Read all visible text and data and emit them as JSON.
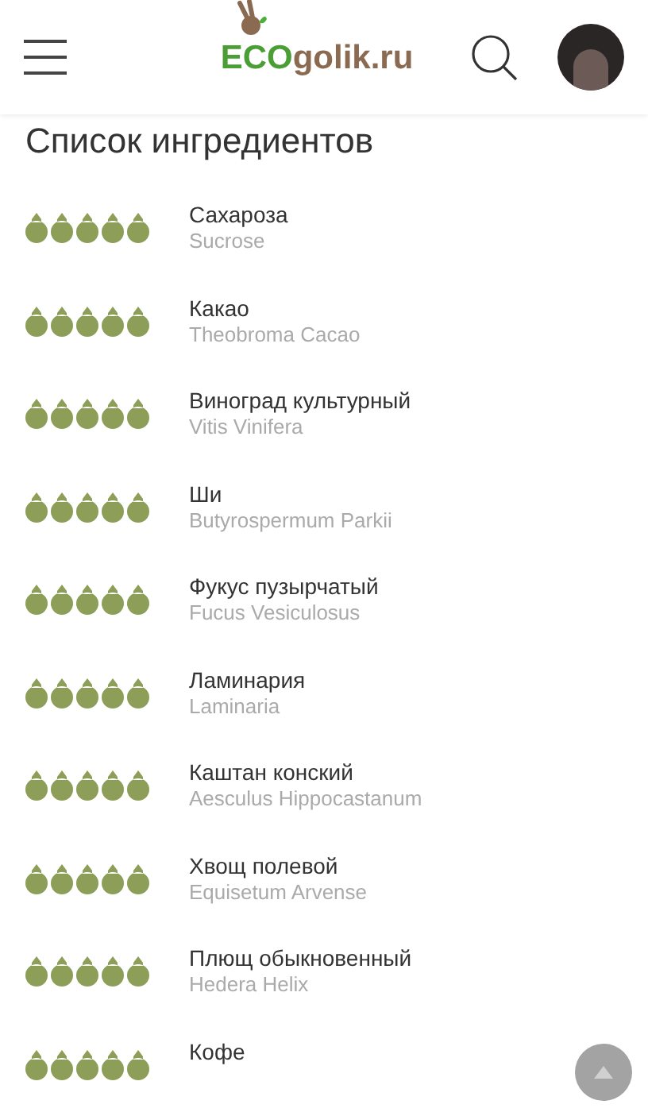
{
  "header": {
    "logo": {
      "part_1": "ECO",
      "part_2": "golik.ru"
    }
  },
  "title": "Список ингредиентов",
  "ingredients": [
    {
      "name": "Сахароза",
      "latin": "Sucrose",
      "stars": 5
    },
    {
      "name": "Какао",
      "latin": "Theobroma Cacao",
      "stars": 5
    },
    {
      "name": "Виноград культурный",
      "latin": "Vitis Vinifera",
      "stars": 5
    },
    {
      "name": "Ши",
      "latin": "Butyrospermum Parkii",
      "stars": 5
    },
    {
      "name": "Фукус пузырчатый",
      "latin": "Fucus Vesiculosus",
      "stars": 5
    },
    {
      "name": "Ламинария",
      "latin": "Laminaria",
      "stars": 5
    },
    {
      "name": "Каштан конский",
      "latin": "Aesculus Hippocastanum",
      "stars": 5
    },
    {
      "name": "Хвощ полевой",
      "latin": "Equisetum Arvense",
      "stars": 5
    },
    {
      "name": "Плющ обыкновенный",
      "latin": "Hedera Helix",
      "stars": 5
    },
    {
      "name": "Кофе",
      "stars": 5
    }
  ]
}
